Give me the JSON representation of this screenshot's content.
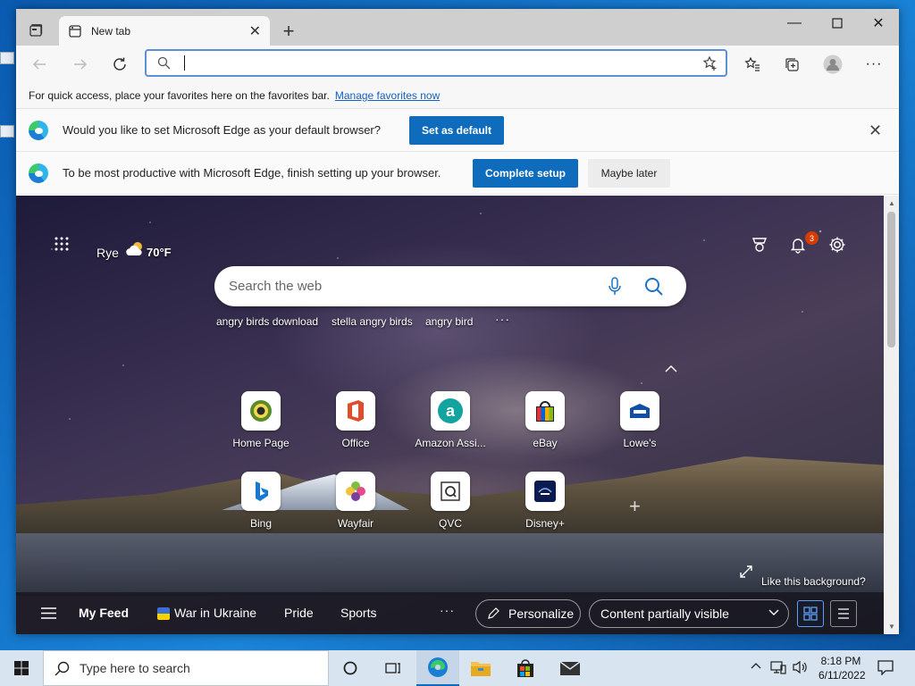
{
  "browser": {
    "tab_title": "New tab",
    "favorites_bar_text": "For quick access, place your favorites here on the favorites bar.",
    "favorites_link": "Manage favorites now",
    "infobar_default": {
      "text": "Would you like to set Microsoft Edge as your default browser?",
      "button": "Set as default"
    },
    "infobar_setup": {
      "text": "To be most productive with Microsoft Edge, finish setting up your browser.",
      "primary": "Complete setup",
      "secondary": "Maybe later"
    }
  },
  "newtab": {
    "weather": {
      "location": "Rye",
      "temp": "70°F"
    },
    "notifications_count": "3",
    "search": {
      "placeholder": "Search the web"
    },
    "suggestions": [
      "angry birds download",
      "stella angry birds",
      "angry bird"
    ],
    "tiles": [
      {
        "label": "Home Page",
        "icon": "homepage-icon"
      },
      {
        "label": "Office",
        "icon": "office-icon"
      },
      {
        "label": "Amazon Assi...",
        "icon": "amazon-icon"
      },
      {
        "label": "eBay",
        "icon": "ebay-icon"
      },
      {
        "label": "Lowe's",
        "icon": "lowes-icon"
      },
      {
        "label": "Bing",
        "icon": "bing-icon"
      },
      {
        "label": "Wayfair",
        "icon": "wayfair-icon"
      },
      {
        "label": "QVC",
        "icon": "qvc-icon"
      },
      {
        "label": "Disney+",
        "icon": "disney-icon"
      }
    ],
    "background_link": "Like this background?",
    "feed": {
      "items": [
        "My Feed",
        "War in Ukraine",
        "Pride",
        "Sports"
      ],
      "personalize": "Personalize",
      "visibility": "Content partially visible"
    }
  },
  "taskbar": {
    "search_placeholder": "Type here to search",
    "time": "8:18 PM",
    "date": "6/11/2022"
  },
  "colors": {
    "accent": "#0f6cbd",
    "focus": "#5b8fd9",
    "badge": "#d83b01"
  }
}
